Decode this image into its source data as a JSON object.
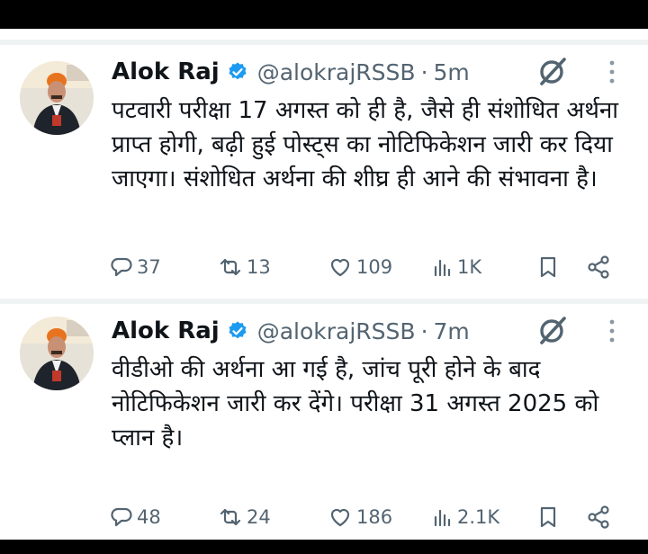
{
  "tweets": [
    {
      "name": "Alok Raj",
      "handle": "@alokrajRSSB",
      "separator": "·",
      "time": "5m",
      "text": "पटवारी परीक्षा 17 अगस्त को ही है, जैसे ही संशोधित अर्थना प्राप्त होगी, बढ़ी हुई पोस्ट्स का नोटिफिकेशन जारी कर दिया जाएगा। संशोधित अर्थना की शीघ्र ही आने की संभावना है।",
      "replies": "37",
      "reposts": "13",
      "likes": "109",
      "views": "1K"
    },
    {
      "name": "Alok Raj",
      "handle": "@alokrajRSSB",
      "separator": "·",
      "time": "7m",
      "text": "वीडीओ की अर्थना आ गई है, जांच पूरी होने के बाद नोटिफिकेशन जारी कर देंगे। परीक्षा 31 अगस्त 2025 को प्लान है।",
      "replies": "48",
      "reposts": "24",
      "likes": "186",
      "views": "2.1K"
    }
  ],
  "colors": {
    "text": "#0f1419",
    "secondary": "#536471",
    "verified": "#1d9bf0",
    "divider": "#eff3f4"
  },
  "icons": [
    "verified-badge-icon",
    "grok-icon",
    "more-icon",
    "reply-icon",
    "repost-icon",
    "like-icon",
    "views-icon",
    "bookmark-icon",
    "share-icon"
  ]
}
